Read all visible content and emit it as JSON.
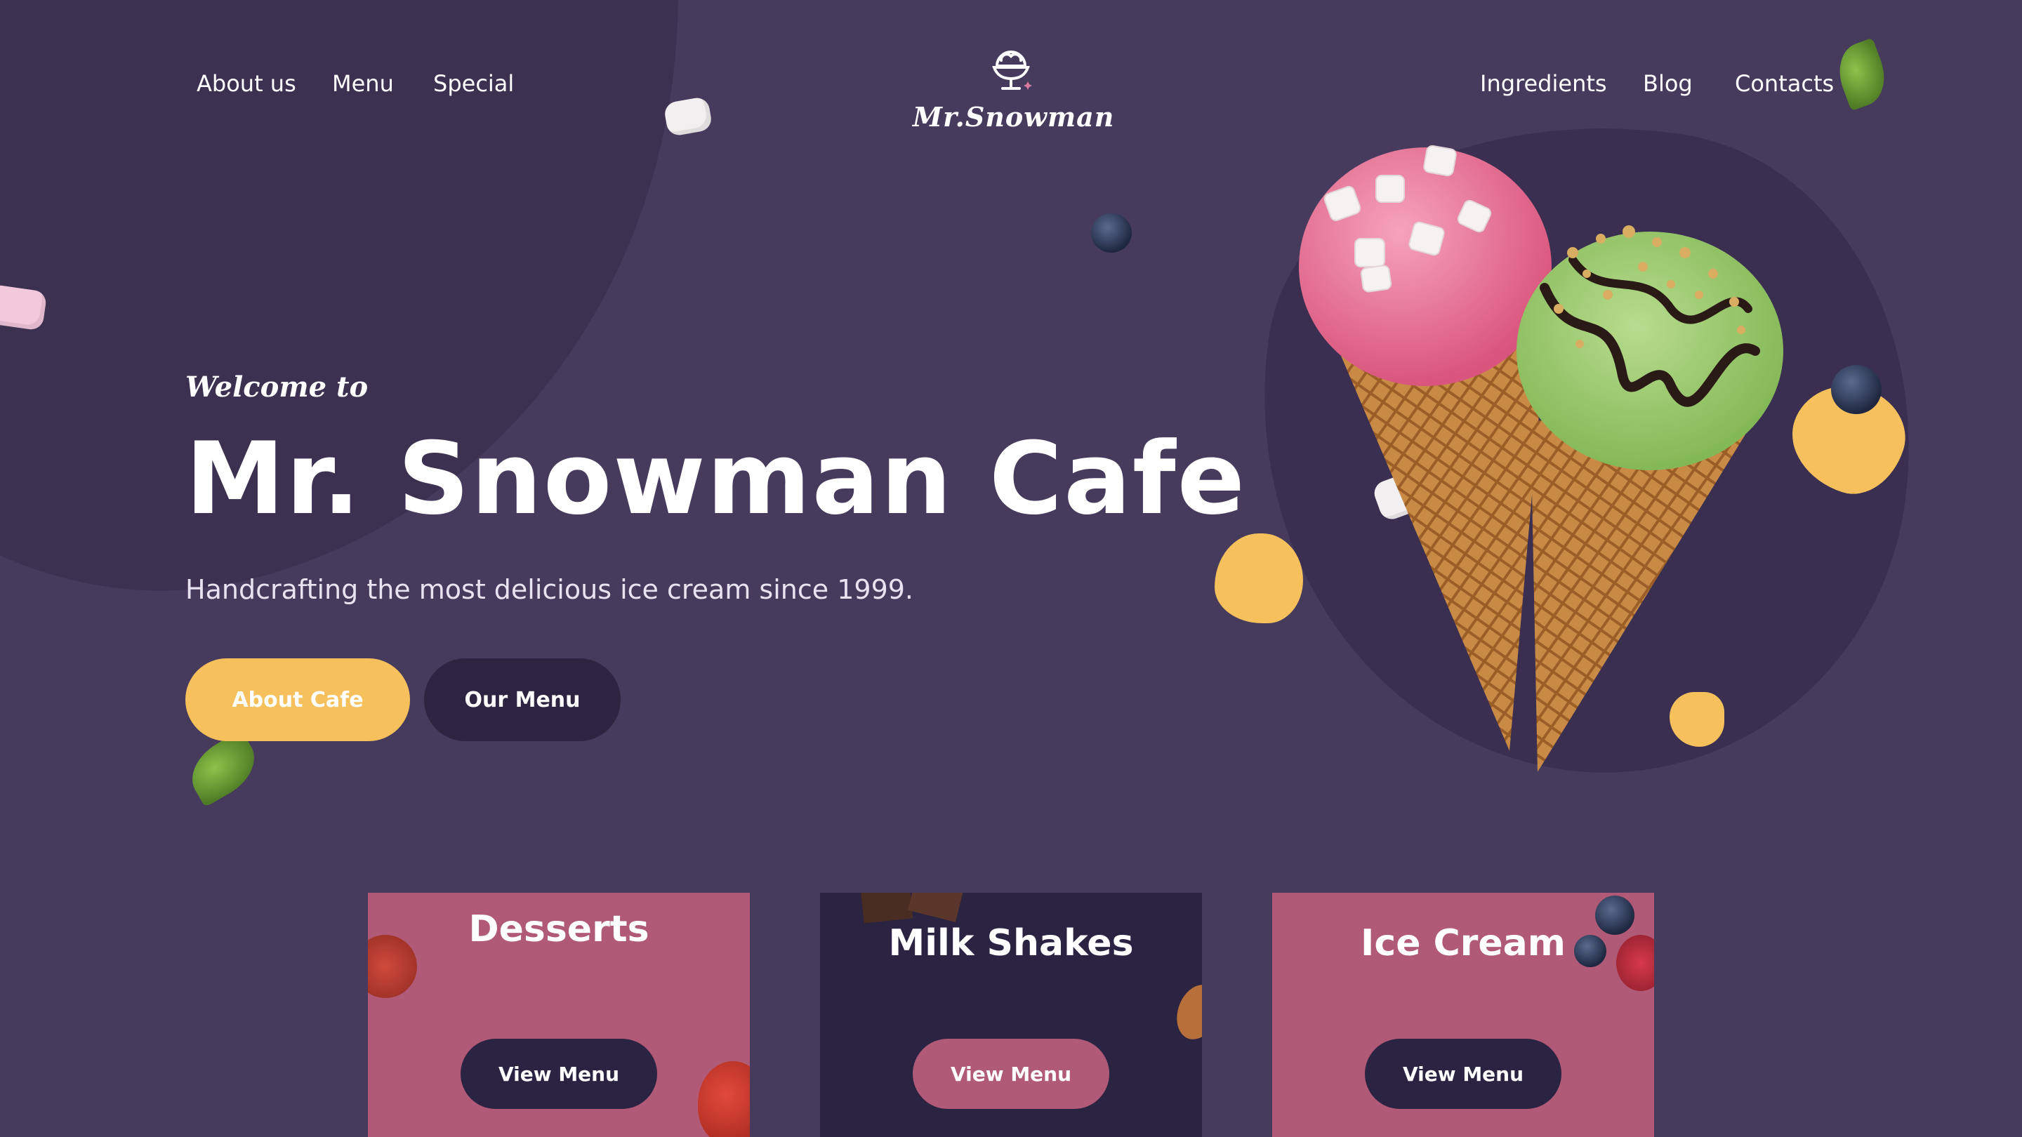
{
  "nav": {
    "left": [
      {
        "label": "About us"
      },
      {
        "label": "Menu"
      },
      {
        "label": "Special"
      }
    ],
    "right": [
      {
        "label": "Ingredients"
      },
      {
        "label": "Blog"
      },
      {
        "label": "Contacts"
      }
    ]
  },
  "logo": {
    "text": "Mr.Snowman",
    "icon": "ice-cream-cup-icon"
  },
  "hero": {
    "welcome": "Welcome to",
    "title": "Mr. Snowman Cafe",
    "subtitle": "Handcrafting the most delicious ice cream since 1999.",
    "primary_button": "About Cafe",
    "secondary_button": "Our Menu"
  },
  "cards": [
    {
      "title": "Desserts",
      "button": "View Menu"
    },
    {
      "title": "Milk Shakes",
      "button": "View Menu"
    },
    {
      "title": "Ice Cream",
      "button": "View Menu"
    }
  ],
  "colors": {
    "background": "#463b5d",
    "accent_yellow": "#f6c15c",
    "card_pink": "#b05a78",
    "card_dark": "#2b2342"
  }
}
